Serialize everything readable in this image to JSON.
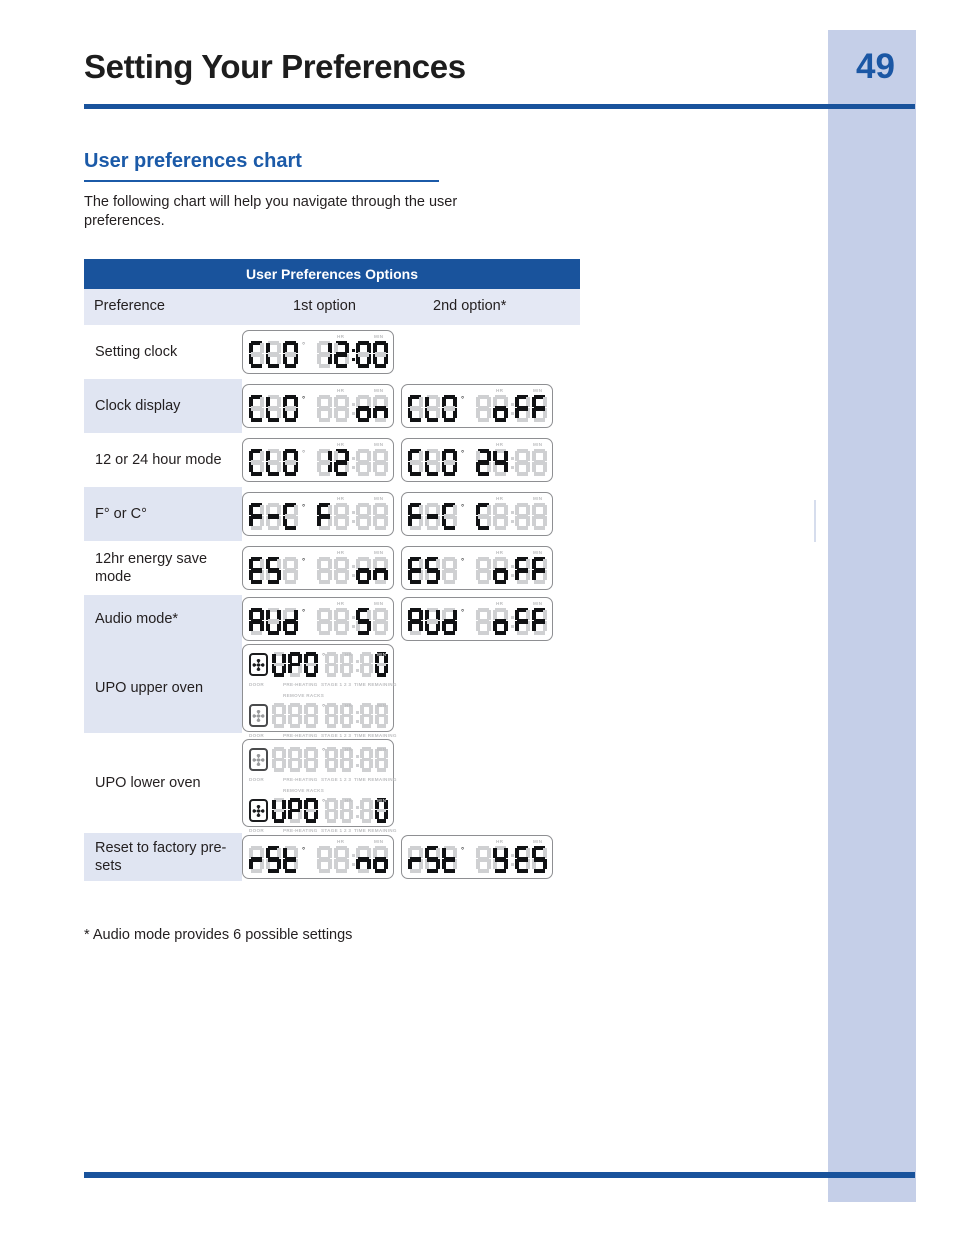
{
  "page": {
    "title": "Setting Your Preferences",
    "number": "49",
    "accent_color": "#19539c",
    "band_color": "#c5cfe8",
    "row_shade_color": "#e0e5f2"
  },
  "section": {
    "heading": "User preferences chart",
    "intro": "The following chart will help you navigate through the user preferences."
  },
  "table": {
    "banner": "User Preferences Options",
    "columns": [
      "Preference",
      "1st option",
      "2nd option*"
    ],
    "rows": [
      {
        "label": "Setting clock",
        "shaded": false,
        "options": [
          {
            "kind": "single",
            "left": "CLO",
            "right": "12:00",
            "right_style": "time",
            "degree": false
          }
        ]
      },
      {
        "label": "Clock display",
        "shaded": true,
        "options": [
          {
            "kind": "single",
            "left": "CLO",
            "right": "on",
            "right_style": "word-2",
            "degree": true
          },
          {
            "kind": "single",
            "left": "CLO",
            "right": "oFF",
            "right_style": "word-3",
            "degree": true
          }
        ]
      },
      {
        "label": "12 or 24 hour mode",
        "shaded": false,
        "options": [
          {
            "kind": "single",
            "left": "CLO",
            "right": "12",
            "right_style": "hr",
            "degree": false,
            "hr_on": true
          },
          {
            "kind": "single",
            "left": "CLO",
            "right": "24",
            "right_style": "hr",
            "degree": true,
            "hr_on": true
          }
        ]
      },
      {
        "label": "F° or C°",
        "shaded": true,
        "options": [
          {
            "kind": "single",
            "left": "F-C",
            "right": "F",
            "right_style": "word-1",
            "degree": true
          },
          {
            "kind": "single",
            "left": "F-C",
            "right": "C",
            "right_style": "word-1",
            "degree": true
          }
        ]
      },
      {
        "label": "12hr energy save mode",
        "shaded": false,
        "options": [
          {
            "kind": "single",
            "left": "ES",
            "right": "on",
            "right_style": "word-2",
            "degree": true
          },
          {
            "kind": "single",
            "left": "ES",
            "right": "oFF",
            "right_style": "word-3",
            "degree": true
          }
        ]
      },
      {
        "label": "Audio mode*",
        "shaded": true,
        "options": [
          {
            "kind": "single",
            "left": "AUd",
            "right": "5",
            "right_style": "one-mid",
            "degree": true
          },
          {
            "kind": "single",
            "left": "AUd",
            "right": "oFF",
            "right_style": "word-3",
            "degree": true
          }
        ]
      },
      {
        "label": "UPO upper oven",
        "shaded": true,
        "options": [
          {
            "kind": "dual",
            "active": "top",
            "left": "UPO",
            "right": "0"
          }
        ]
      },
      {
        "label": "UPO lower oven",
        "shaded": false,
        "options": [
          {
            "kind": "dual",
            "active": "bottom",
            "left": "UPO",
            "right": "0"
          }
        ]
      },
      {
        "label": "Reset to factory pre-sets",
        "shaded": true,
        "options": [
          {
            "kind": "single",
            "left": "rSt",
            "right": "no",
            "right_style": "word-2",
            "degree": true
          },
          {
            "kind": "single",
            "left": "rSt",
            "right": "yES",
            "right_style": "word-3",
            "degree": true
          }
        ]
      }
    ]
  },
  "lcd_labels": {
    "hr": "HR",
    "min": "MIN",
    "degree": "°",
    "door": "DOOR",
    "preheating": "PRE-HEATING",
    "stage": "STAGE 1 2 3",
    "time_remaining": "TIME REMAINING",
    "remove_racks": "REMOVE RACKS"
  },
  "footnote": "* Audio mode provides 6 possible settings"
}
